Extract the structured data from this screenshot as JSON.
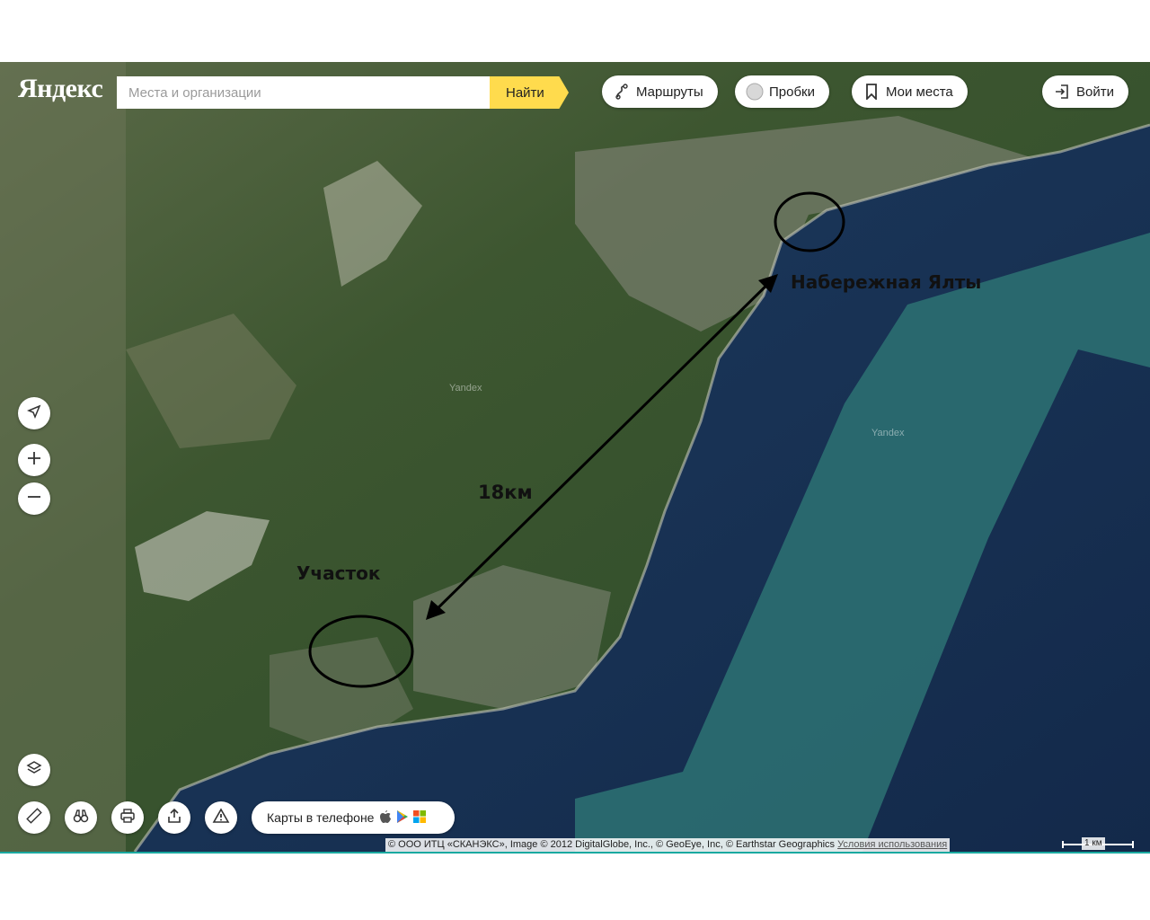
{
  "header": {
    "logo": "Яндекс",
    "search_placeholder": "Места и организации",
    "find_label": "Найти",
    "routes_label": "Маршруты",
    "traffic_label": "Пробки",
    "my_places_label": "Мои места",
    "login_label": "Войти"
  },
  "controls": {
    "locate_icon": "navigation-arrow-icon",
    "zoom_in_icon": "plus-icon",
    "zoom_out_icon": "minus-icon",
    "layers_icon": "layers-icon",
    "ruler_icon": "ruler-icon",
    "panorama_icon": "binoculars-icon",
    "print_icon": "printer-icon",
    "share_icon": "share-icon",
    "report_icon": "warning-icon"
  },
  "phone_promo": {
    "label": "Карты в телефоне"
  },
  "annotations": {
    "embankment": "Набережная Ялты",
    "plot": "Участок",
    "distance": "18км"
  },
  "watermark": "Yandex",
  "footer": {
    "copyright": "© ООО ИТЦ «СКАНЭКС», Image © 2012 DigitalGlobe, Inc., © GeoEye, Inc, © Earthstar Geographics",
    "terms": "Условия использования",
    "scale": "1 км"
  },
  "colors": {
    "accent": "#ffdb4d",
    "sea_dark": "#142c4e",
    "sea_teal": "#2b6f70",
    "land": "#3f5a32"
  }
}
